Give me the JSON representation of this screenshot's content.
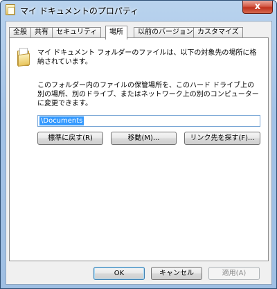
{
  "window": {
    "title": "マイ ドキュメントのプロパティ",
    "close_label": "x"
  },
  "tabs": [
    {
      "label": "全般"
    },
    {
      "label": "共有"
    },
    {
      "label": "セキュリティ"
    },
    {
      "label": "場所",
      "active": true
    },
    {
      "label": "以前のバージョン"
    },
    {
      "label": "カスタマイズ"
    }
  ],
  "location_tab": {
    "folder_icon": "documents-folder-icon",
    "description1": "マイ ドキュメント フォルダーのファイルは、以下の対象先の場所に格納されています。",
    "description2": "このフォルダー内のファイルの保管場所を、このハード ドライブ上の別の場所、別のドライブ、またはネットワーク上の別のコンピューターに変更できます。",
    "path_value": "\\Documents",
    "buttons": {
      "restore": "標準に戻す(R)",
      "move": "移動(M)...",
      "find_target": "リンク先を探す(F)..."
    }
  },
  "footer": {
    "ok": "OK",
    "cancel": "キャンセル",
    "apply": "適用(A)"
  }
}
